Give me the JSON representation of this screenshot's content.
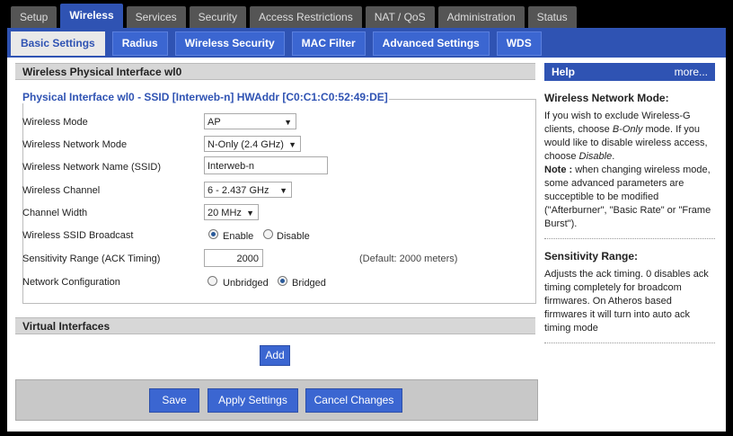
{
  "main_tabs": [
    {
      "label": "Setup"
    },
    {
      "label": "Wireless",
      "active": true
    },
    {
      "label": "Services"
    },
    {
      "label": "Security"
    },
    {
      "label": "Access Restrictions"
    },
    {
      "label": "NAT / QoS"
    },
    {
      "label": "Administration"
    },
    {
      "label": "Status"
    }
  ],
  "sub_tabs": [
    {
      "label": "Basic Settings",
      "active": true
    },
    {
      "label": "Radius"
    },
    {
      "label": "Wireless Security"
    },
    {
      "label": "MAC Filter"
    },
    {
      "label": "Advanced Settings"
    },
    {
      "label": "WDS"
    }
  ],
  "physical_section": {
    "title": "Wireless Physical Interface wl0",
    "legend": "Physical Interface wl0 - SSID [Interweb-n] HWAddr [C0:C1:C0:52:49:DE]"
  },
  "fields": {
    "wireless_mode": {
      "label": "Wireless Mode",
      "value": "AP"
    },
    "network_mode": {
      "label": "Wireless Network Mode",
      "value": "N-Only (2.4 GHz)"
    },
    "ssid": {
      "label": "Wireless Network Name (SSID)",
      "value": "Interweb-n"
    },
    "channel": {
      "label": "Wireless Channel",
      "value": "6 - 2.437 GHz"
    },
    "channel_width": {
      "label": "Channel Width",
      "value": "20 MHz"
    },
    "ssid_broadcast": {
      "label": "Wireless SSID Broadcast",
      "option1": "Enable",
      "option2": "Disable",
      "selected": "Enable"
    },
    "sensitivity": {
      "label": "Sensitivity Range (ACK Timing)",
      "value": "2000",
      "note": "(Default: 2000 meters)"
    },
    "network_config": {
      "label": "Network Configuration",
      "option1": "Unbridged",
      "option2": "Bridged",
      "selected": "Bridged"
    }
  },
  "virtual_section": {
    "title": "Virtual Interfaces",
    "add_label": "Add"
  },
  "footer": {
    "save": "Save",
    "apply": "Apply Settings",
    "cancel": "Cancel Changes"
  },
  "help": {
    "title": "Help",
    "more": "more...",
    "section1_title": "Wireless Network Mode:",
    "section1_p1": "If you wish to exclude Wireless-G clients, choose ",
    "section1_p1_em": "B-Only",
    "section1_p2": " mode. If you would like to disable wireless access, choose ",
    "section1_p2_em": "Disable",
    "section1_p3": ".",
    "section1_note_label": "Note :",
    "section1_note": " when changing wireless mode, some advanced parameters are succeptible to be modified (\"Afterburner\", \"Basic Rate\" or \"Frame Burst\").",
    "section2_title": "Sensitivity Range:",
    "section2_body": "Adjusts the ack timing. 0 disables ack timing completely for broadcom firmwares. On Atheros based firmwares it will turn into auto ack timing mode"
  }
}
